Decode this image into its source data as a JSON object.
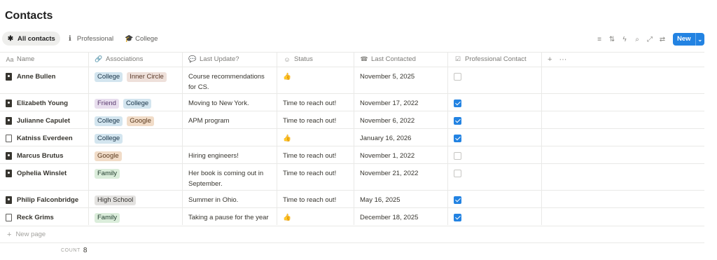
{
  "page": {
    "title": "Contacts"
  },
  "tabs": [
    {
      "label": "All contacts",
      "icon": "asterisk-icon",
      "glyph": "✱",
      "active": true
    },
    {
      "label": "Professional",
      "icon": "info-icon",
      "glyph": "ℹ",
      "active": false
    },
    {
      "label": "College",
      "icon": "graduation-cap-icon",
      "glyph": "🎓",
      "active": false
    }
  ],
  "toolbar": {
    "icons": [
      {
        "name": "filter-icon",
        "glyph": "≡"
      },
      {
        "name": "sort-icon",
        "glyph": "⇅"
      },
      {
        "name": "automation-lightning-icon",
        "glyph": "ϟ"
      },
      {
        "name": "search-icon",
        "glyph": "⌕"
      },
      {
        "name": "expand-icon",
        "glyph": "⤢"
      },
      {
        "name": "settings-sliders-icon",
        "glyph": "⇄"
      }
    ],
    "new_label": "New",
    "accent": "#2383e2"
  },
  "columns": [
    {
      "key": "name",
      "label": "Name",
      "icon": "text-aa-icon",
      "glyph": "Aa"
    },
    {
      "key": "associations",
      "label": "Associations",
      "icon": "link-icon",
      "glyph": "🔗"
    },
    {
      "key": "last_update",
      "label": "Last Update?",
      "icon": "chat-bubble-icon",
      "glyph": "💬"
    },
    {
      "key": "status",
      "label": "Status",
      "icon": "smiley-icon",
      "glyph": "☺"
    },
    {
      "key": "last_contacted",
      "label": "Last Contacted",
      "icon": "phone-icon",
      "glyph": "☎"
    },
    {
      "key": "professional",
      "label": "Professional Contact",
      "icon": "checkbox-icon",
      "glyph": "☑"
    }
  ],
  "header_extra": {
    "add_glyph": "+",
    "more_glyph": "···"
  },
  "rows": [
    {
      "name": "Anne Bullen",
      "icon": "contact",
      "tags": [
        "College",
        "Inner Circle"
      ],
      "update": "Course recommendations for CS.",
      "status": "👍",
      "contacted": "November 5, 2025",
      "professional": false
    },
    {
      "name": "Elizabeth Young",
      "icon": "contact",
      "tags": [
        "Friend",
        "College"
      ],
      "update": "Moving to New York.",
      "status": "Time to reach out!",
      "contacted": "November 17, 2022",
      "professional": true
    },
    {
      "name": "Julianne Capulet",
      "icon": "contact",
      "tags": [
        "College",
        "Google"
      ],
      "update": "APM program",
      "status": "Time to reach out!",
      "contacted": "November 6, 2022",
      "professional": true
    },
    {
      "name": "Katniss Everdeen",
      "icon": "doc",
      "tags": [
        "College"
      ],
      "update": "",
      "status": "👍",
      "contacted": "January 16, 2026",
      "professional": true
    },
    {
      "name": "Marcus Brutus",
      "icon": "contact",
      "tags": [
        "Google"
      ],
      "update": "Hiring engineers!",
      "status": "Time to reach out!",
      "contacted": "November 1, 2022",
      "professional": false
    },
    {
      "name": "Ophelia Winslet",
      "icon": "contact",
      "tags": [
        "Family"
      ],
      "update": "Her book is coming out in September.",
      "status": "Time to reach out!",
      "contacted": "November 21, 2022",
      "professional": false
    },
    {
      "name": "Philip Falconbridge",
      "icon": "contact",
      "tags": [
        "High School"
      ],
      "update": "Summer in Ohio.",
      "status": "Time to reach out!",
      "contacted": "May 16, 2025",
      "professional": true
    },
    {
      "name": "Reck Grims",
      "icon": "doc",
      "tags": [
        "Family"
      ],
      "update": "Taking a pause for the year",
      "status": "👍",
      "contacted": "December 18, 2025",
      "professional": true
    }
  ],
  "new_page_label": "New page",
  "footer": {
    "count_label": "COUNT",
    "count_value": "8"
  }
}
